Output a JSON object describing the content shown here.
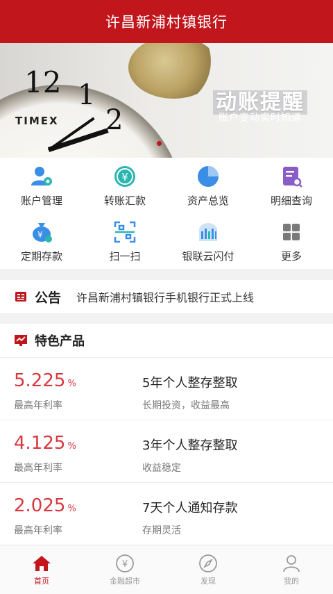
{
  "header": {
    "title": "许昌新浦村镇银行"
  },
  "banner": {
    "title": "动账提醒",
    "subtitle": "账户变动实时知道",
    "brand": "TIMEX",
    "clock_numbers": [
      "12",
      "1",
      "2"
    ]
  },
  "menu": [
    {
      "label": "账户管理",
      "icon": "account-management-icon"
    },
    {
      "label": "转账汇款",
      "icon": "transfer-icon"
    },
    {
      "label": "资产总览",
      "icon": "asset-overview-icon"
    },
    {
      "label": "明细查询",
      "icon": "detail-query-icon"
    },
    {
      "label": "定期存款",
      "icon": "fixed-deposit-icon"
    },
    {
      "label": "扫一扫",
      "icon": "scan-icon"
    },
    {
      "label": "银联云闪付",
      "icon": "unionpay-quickpass-icon"
    },
    {
      "label": "更多",
      "icon": "more-grid-icon"
    }
  ],
  "notice": {
    "title": "公告",
    "text": "许昌新浦村镇银行手机银行正式上线"
  },
  "products": {
    "title": "特色产品",
    "items": [
      {
        "rate": "5.225",
        "unit": "%",
        "rate_label": "最高年利率",
        "name": "5年个人整存整取",
        "desc": "长期投资，收益最高"
      },
      {
        "rate": "4.125",
        "unit": "%",
        "rate_label": "最高年利率",
        "name": "3年个人整存整取",
        "desc": "收益稳定"
      },
      {
        "rate": "2.025",
        "unit": "%",
        "rate_label": "最高年利率",
        "name": "7天个人通知存款",
        "desc": "存期灵活"
      }
    ]
  },
  "tabbar": [
    {
      "label": "首页",
      "icon": "home-icon",
      "active": true
    },
    {
      "label": "金融超市",
      "icon": "yen-circle-icon",
      "active": false
    },
    {
      "label": "发现",
      "icon": "compass-icon",
      "active": false
    },
    {
      "label": "我的",
      "icon": "user-icon",
      "active": false
    }
  ],
  "colors": {
    "brand_red": "#c0161c",
    "rate_red": "#d9373f",
    "icon_blue": "#3a8ee6",
    "icon_teal": "#2bb6b0",
    "icon_purple": "#8a5cc6",
    "icon_gray": "#7a7a7a"
  }
}
